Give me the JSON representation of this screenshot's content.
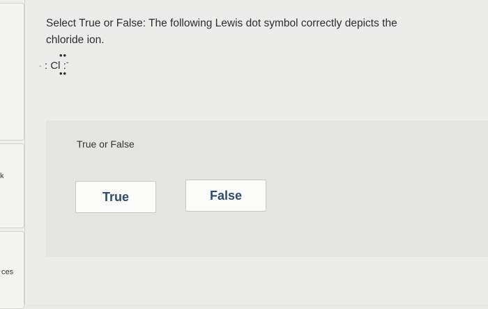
{
  "sidebar": {
    "items": [
      "k",
      "ces"
    ]
  },
  "question": {
    "prompt": "Select True or False: The following Lewis dot symbol correctly depicts the chloride ion.",
    "lewis_symbol": {
      "element": "Cl",
      "left_dots": ":",
      "right_dots": ":",
      "charge": "-"
    }
  },
  "answer": {
    "label": "True or False",
    "options": [
      "True",
      "False"
    ]
  }
}
